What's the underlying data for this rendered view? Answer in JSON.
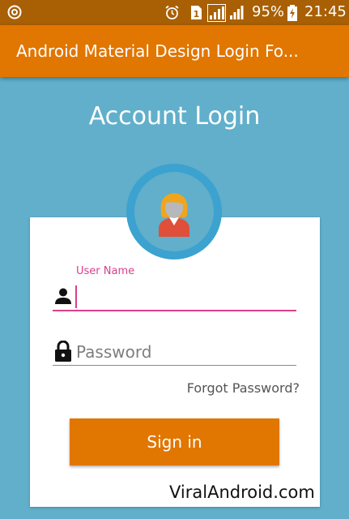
{
  "status_bar": {
    "battery_percent": "95%",
    "time": "21:45",
    "icons": [
      "app-indicator-icon",
      "alarm-icon",
      "sim-icon",
      "signal-icon",
      "signal-icon",
      "battery-charging-icon"
    ]
  },
  "app_bar": {
    "title": "Android Material Design Login Fo..."
  },
  "page": {
    "title": "Account Login"
  },
  "form": {
    "username": {
      "label": "User Name",
      "value": "",
      "icon": "user-icon"
    },
    "password": {
      "placeholder": "Password",
      "value": "",
      "icon": "lock-icon"
    },
    "forgot_password": "Forgot Password?",
    "sign_in": "Sign in"
  },
  "watermark": "ViralAndroid.com",
  "colors": {
    "status_bar": "#a95f03",
    "app_bar": "#e17600",
    "background": "#61afcb",
    "accent": "#d9408c",
    "button": "#e17600"
  }
}
